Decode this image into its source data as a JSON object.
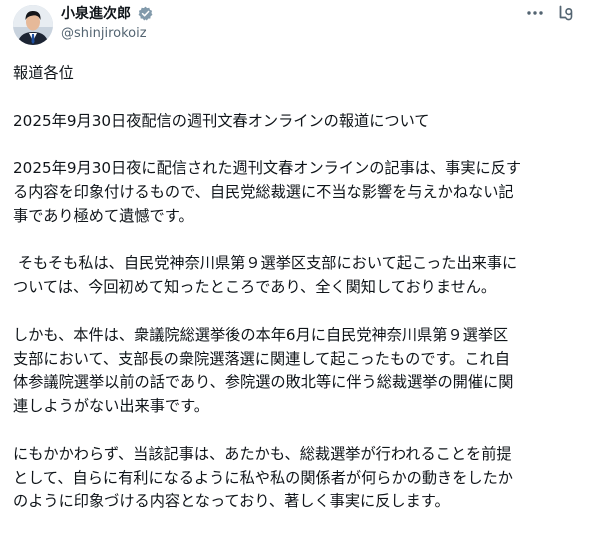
{
  "author": {
    "display_name": "小泉進次郎",
    "handle": "@shinjirokoiz",
    "verified": true,
    "avatar_icon": "avatar-photo"
  },
  "header_actions": {
    "more_icon": "more-dots-icon",
    "grok_icon": "grok-icon"
  },
  "tweet": {
    "paragraphs": [
      [
        "報道各位"
      ],
      [
        "2025年9月30日夜配信の週刊文春オンラインの報道について"
      ],
      [
        "2025年9月30日夜に配信された週刊文春オンラインの記事は、事実に反す",
        "る内容を印象付けるもので、自民党総裁選に不当な影響を与えかねない記",
        "事であり極めて遺憾です。"
      ],
      [
        " そもそも私は、自民党神奈川県第９選挙区支部において起こった出来事に",
        "ついては、今回初めて知ったところであり、全く関知しておりません。"
      ],
      [
        "しかも、本件は、衆議院総選挙後の本年6月に自民党神奈川県第９選挙区",
        "支部において、支部長の衆院選落選に関連して起こったものです。これ自",
        "体参議院選挙以前の話であり、参院選の敗北等に伴う総裁選挙の開催に関",
        "連しようがない出来事です。"
      ],
      [
        "にもかかわらず、当該記事は、あたかも、総裁選挙が行われることを前提",
        "として、自らに有利になるように私や私の関係者が何らかの動きをしたか",
        "のように印象づける内容となっており、著しく事実に反します。"
      ]
    ]
  },
  "colors": {
    "text": "#0f1419",
    "secondary_text": "#536471",
    "verified_badge": "#829aab"
  }
}
